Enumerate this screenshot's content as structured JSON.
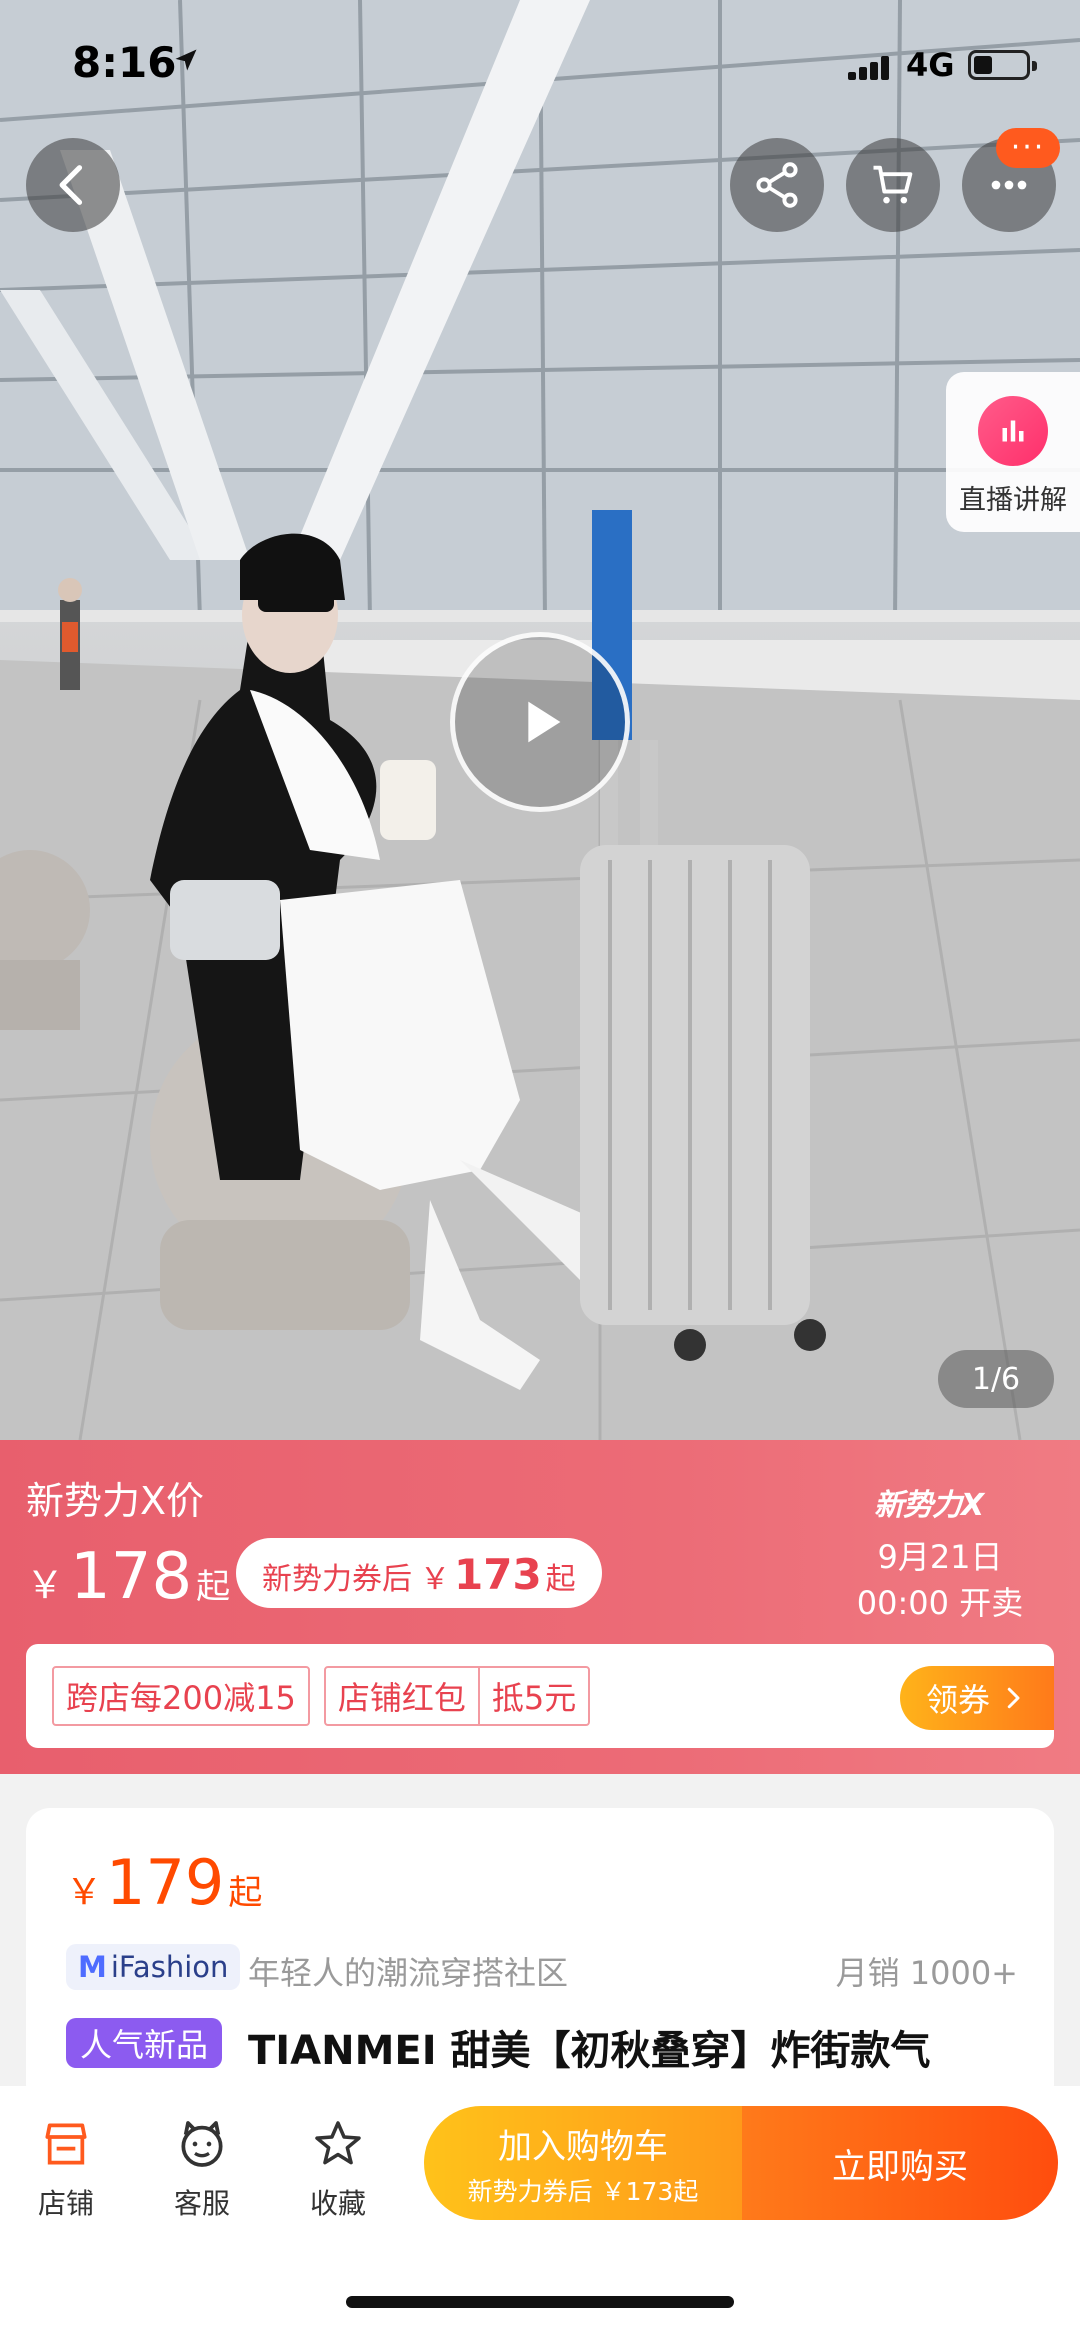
{
  "status_bar": {
    "time": "8:16",
    "network": "4G"
  },
  "hero": {
    "live_label": "直播讲解",
    "page_indicator": "1/6",
    "badge_dots": "···"
  },
  "promo": {
    "title": "新势力X价",
    "price_yen": "￥",
    "price_value": "178",
    "price_suffix": "起",
    "coupon_label": "新势力券后",
    "coupon_yen": "￥",
    "coupon_value": "173",
    "coupon_suffix": "起",
    "brand": "新势力X",
    "sale_date": "9月21日",
    "sale_time": "00:00 开卖",
    "tags": [
      "跨店每200减15"
    ],
    "shop_tag_left": "店铺红包",
    "shop_tag_right": "抵5元",
    "get_coupon": "领券"
  },
  "product": {
    "price_yen": "￥",
    "price_value": "179",
    "price_suffix": "起",
    "ifashion_m": "M",
    "ifashion_text": "iFashion",
    "slogan": "年轻人的潮流穿搭社区",
    "monthly_sales": "月销 1000+",
    "new_badge": "人气新品",
    "title": "TIANMEI 甜美【初秋叠穿】炸街款气"
  },
  "bottom_bar": {
    "shop": "店铺",
    "service": "客服",
    "favorite": "收藏",
    "add_to_cart": "加入购物车",
    "add_to_cart_sub": "新势力券后 ￥173起",
    "buy_now": "立即购买"
  },
  "colors": {
    "accent_orange": "#ff4a00",
    "promo_pink": "#e85f6d",
    "cart_yellow": "#ffc21a",
    "buy_orange": "#ff4d0e",
    "new_badge_purple": "#8c5bf0"
  }
}
